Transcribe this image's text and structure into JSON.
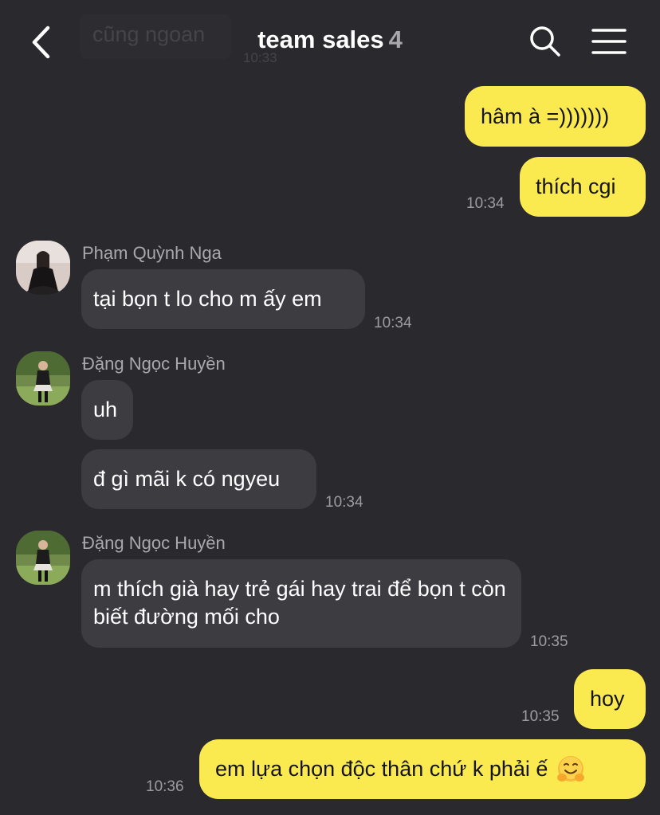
{
  "header": {
    "back_icon": "chevron-left-icon",
    "title": "team sales",
    "member_count": "4",
    "search_icon": "search-icon",
    "menu_icon": "hamburger-menu-icon",
    "ghost_message": "cũng ngoan",
    "ghost_time": "10:33"
  },
  "colors": {
    "background": "#2a292e",
    "outgoing_bubble": "#fbea4f",
    "incoming_bubble": "#3d3c41",
    "timestamp": "#9d9ca1"
  },
  "messages": [
    {
      "direction": "outgoing",
      "text": "hâm à =)))))))"
    },
    {
      "direction": "outgoing",
      "text": "thích cgi",
      "time": "10:34"
    },
    {
      "direction": "incoming",
      "sender": "Phạm Quỳnh Nga",
      "text": "tại bọn t lo cho m ấy em",
      "time": "10:34"
    },
    {
      "direction": "incoming",
      "sender": "Đặng Ngọc Huyền",
      "text": "uh"
    },
    {
      "direction": "incoming",
      "text": "đ gì mãi k có ngyeu",
      "time": "10:34"
    },
    {
      "direction": "incoming",
      "sender": "Đặng Ngọc Huyền",
      "text": "m thích già hay trẻ gái hay trai để bọn t còn biết đường mối cho",
      "time": "10:35"
    },
    {
      "direction": "outgoing",
      "text": "hoy",
      "time": "10:35"
    },
    {
      "direction": "outgoing",
      "text": "em lựa chọn độc thân chứ k phải ế",
      "emoji": "hugging-face-emoji",
      "time": "10:36"
    }
  ]
}
